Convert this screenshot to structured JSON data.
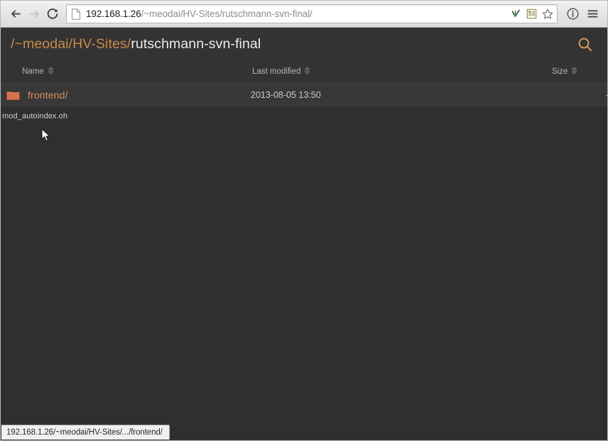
{
  "browser": {
    "back_label": "Back",
    "forward_label": "Forward",
    "reload_label": "Reload",
    "url_host": "192.168.1.26",
    "url_path": "/~meodai/HV-Sites/rutschmann-svn-final/",
    "url_full": "192.168.1.26/~meodai/HV-Sites/rutschmann-svn-final/",
    "omnibox_icons": [
      "page-icon",
      "evernote-clipper-icon",
      "reader-mode-icon",
      "bookmark-star-icon"
    ],
    "toolbar_icons": [
      "info-circle-icon",
      "hamburger-menu-icon"
    ]
  },
  "directory": {
    "breadcrumb": {
      "root_sep": "/",
      "segments": [
        {
          "label": "~meodai",
          "sep": "/",
          "current": false
        },
        {
          "label": "HV-Sites",
          "sep": "/",
          "current": false
        },
        {
          "label": "rutschmann-svn-final",
          "sep": "",
          "current": true
        }
      ]
    },
    "search_icon": "search-icon",
    "columns": [
      {
        "key": "name",
        "label": "Name",
        "sortable": true
      },
      {
        "key": "modified",
        "label": "Last modified",
        "sortable": true
      },
      {
        "key": "size",
        "label": "Size",
        "sortable": true
      }
    ],
    "rows": [
      {
        "icon": "folder-icon",
        "name": "frontend/",
        "modified": "2013-08-05 13:50",
        "size": "-"
      }
    ],
    "footer_note": "mod_autoindex.oh"
  },
  "status_bar": {
    "text": "192.168.1.26/~meodai/HV-Sites/.../frontend/"
  },
  "colors": {
    "page_background": "#2f2f2f",
    "header_background": "#333333",
    "row_background": "#383838",
    "accent_orange": "#d98f5f",
    "breadcrumb_orange": "#c98b4b",
    "folder_orange": "#d9714c",
    "text_primary": "#e8e8e8",
    "text_secondary": "#c6c6c6"
  }
}
